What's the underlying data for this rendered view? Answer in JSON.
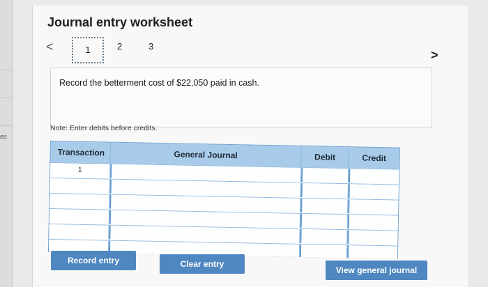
{
  "worksheet": {
    "title": "Journal entry worksheet",
    "side_label": "es",
    "nav": {
      "prev_icon": "chevron-left-icon",
      "next_icon": "chevron-right-icon",
      "prev_glyph": "<",
      "next_glyph": ">",
      "pages": [
        "1",
        "2",
        "3"
      ],
      "active_page": "1"
    },
    "instruction": "Record the betterment cost of $22,050 paid in cash.",
    "note": "Note: Enter debits before credits."
  },
  "journal": {
    "columns": [
      "Transaction",
      "General Journal",
      "Debit",
      "Credit"
    ],
    "rows": [
      {
        "transaction": "1",
        "account": "",
        "debit": "",
        "credit": ""
      },
      {
        "transaction": "",
        "account": "",
        "debit": "",
        "credit": ""
      },
      {
        "transaction": "",
        "account": "",
        "debit": "",
        "credit": ""
      },
      {
        "transaction": "",
        "account": "",
        "debit": "",
        "credit": ""
      },
      {
        "transaction": "",
        "account": "",
        "debit": "",
        "credit": ""
      },
      {
        "transaction": "",
        "account": "",
        "debit": "",
        "credit": ""
      }
    ]
  },
  "actions": {
    "record": "Record entry",
    "clear": "Clear entry",
    "view": "View general journal"
  },
  "colors": {
    "button": "#4f87c0",
    "header": "#a8cbea",
    "border": "#6c9fcf"
  }
}
